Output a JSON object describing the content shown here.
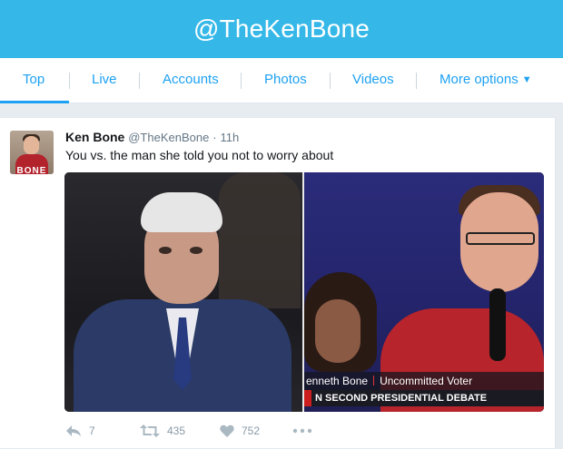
{
  "header": {
    "title": "@TheKenBone"
  },
  "tabs": [
    {
      "label": "Top"
    },
    {
      "label": "Live"
    },
    {
      "label": "Accounts"
    },
    {
      "label": "Photos"
    },
    {
      "label": "Videos"
    },
    {
      "label": "More options"
    }
  ],
  "tweet": {
    "name": "Ken Bone",
    "handle": "@TheKenBone",
    "separator": "·",
    "time": "11h",
    "text": "You vs. the man she told you not to worry about",
    "avatar_text": "BONE",
    "media": {
      "caption_name": "enneth Bone",
      "caption_role": "Uncommitted Voter",
      "caption_prefix": "N",
      "caption_event": "SECOND PRESIDENTIAL DEBATE"
    },
    "actions": {
      "reply_icon": "reply-icon",
      "replies": "7",
      "retweet_icon": "retweet-icon",
      "retweets": "435",
      "like_icon": "heart-icon",
      "likes": "752",
      "more_icon": "more-icon"
    }
  },
  "colors": {
    "header_bg": "#35b8e8",
    "accent": "#1da1f2",
    "page_bg": "#e6ecf0"
  }
}
